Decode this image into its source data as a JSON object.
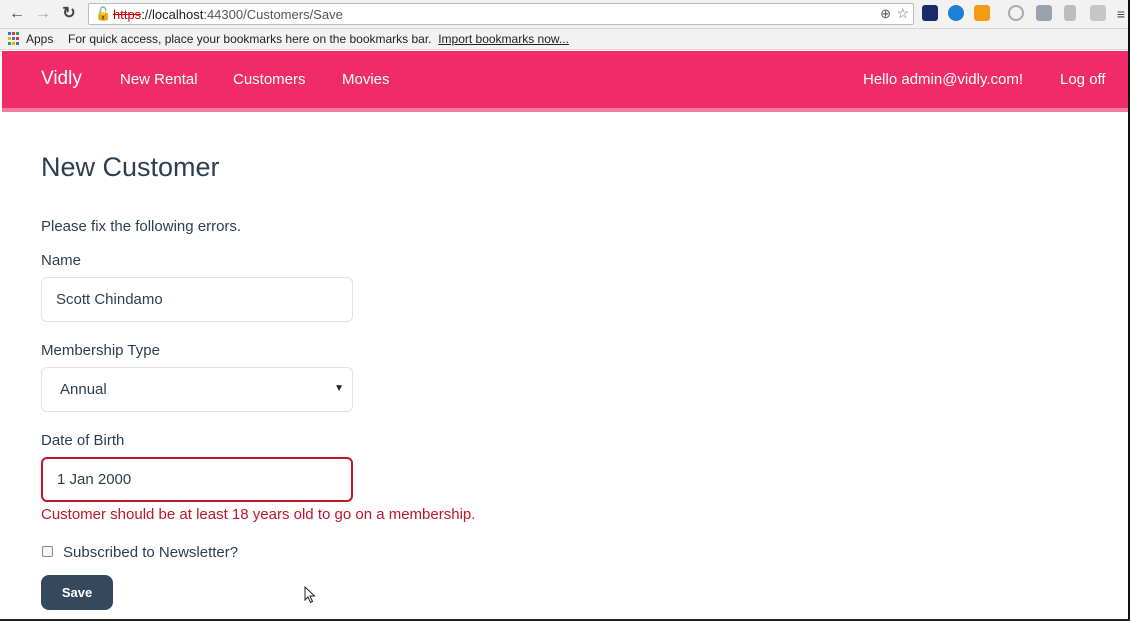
{
  "browser": {
    "url_scheme": "https",
    "url_host": "://localhost",
    "url_rest": ":44300/Customers/Save",
    "apps_label": "Apps",
    "bookmarks_hint": "For quick access, place your bookmarks here on the bookmarks bar.",
    "import_link": "Import bookmarks now..."
  },
  "navbar": {
    "brand": "Vidly",
    "links": [
      "New Rental",
      "Customers",
      "Movies"
    ],
    "greeting": "Hello admin@vidly.com!",
    "logoff": "Log off",
    "color": "#ef2b69"
  },
  "form": {
    "title": "New Customer",
    "error_summary": "Please fix the following errors.",
    "name_label": "Name",
    "name_value": "Scott Chindamo",
    "membership_label": "Membership Type",
    "membership_value": "Annual",
    "dob_label": "Date of Birth",
    "dob_value": "1 Jan 2000",
    "dob_error": "Customer should be at least 18 years old to go on a membership.",
    "newsletter_label": "Subscribed to Newsletter?",
    "newsletter_checked": false,
    "save_label": "Save",
    "error_color": "#c0152b"
  }
}
